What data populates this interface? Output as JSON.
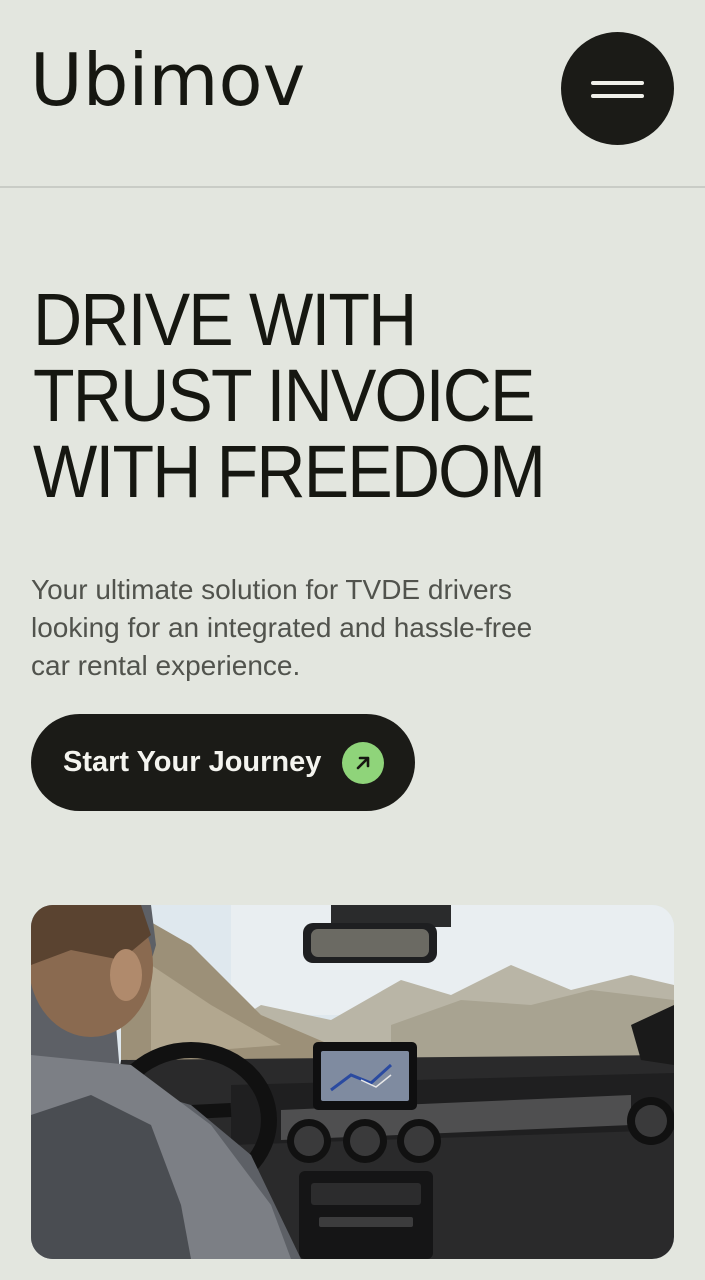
{
  "header": {
    "logo_text": "Ubimov",
    "menu_icon": "hamburger-menu-icon"
  },
  "hero": {
    "title": "DRIVE WITH TRUST INVOICE WITH FREEDOM",
    "subtitle": "Your ultimate solution for TVDE drivers looking for an integrated and hassle-free car rental experience.",
    "cta_label": "Start Your Journey",
    "cta_icon": "arrow-up-right-icon"
  },
  "colors": {
    "background": "#e3e6df",
    "dark": "#1b1b17",
    "accent": "#8fd47a",
    "text_muted": "#51534d"
  }
}
